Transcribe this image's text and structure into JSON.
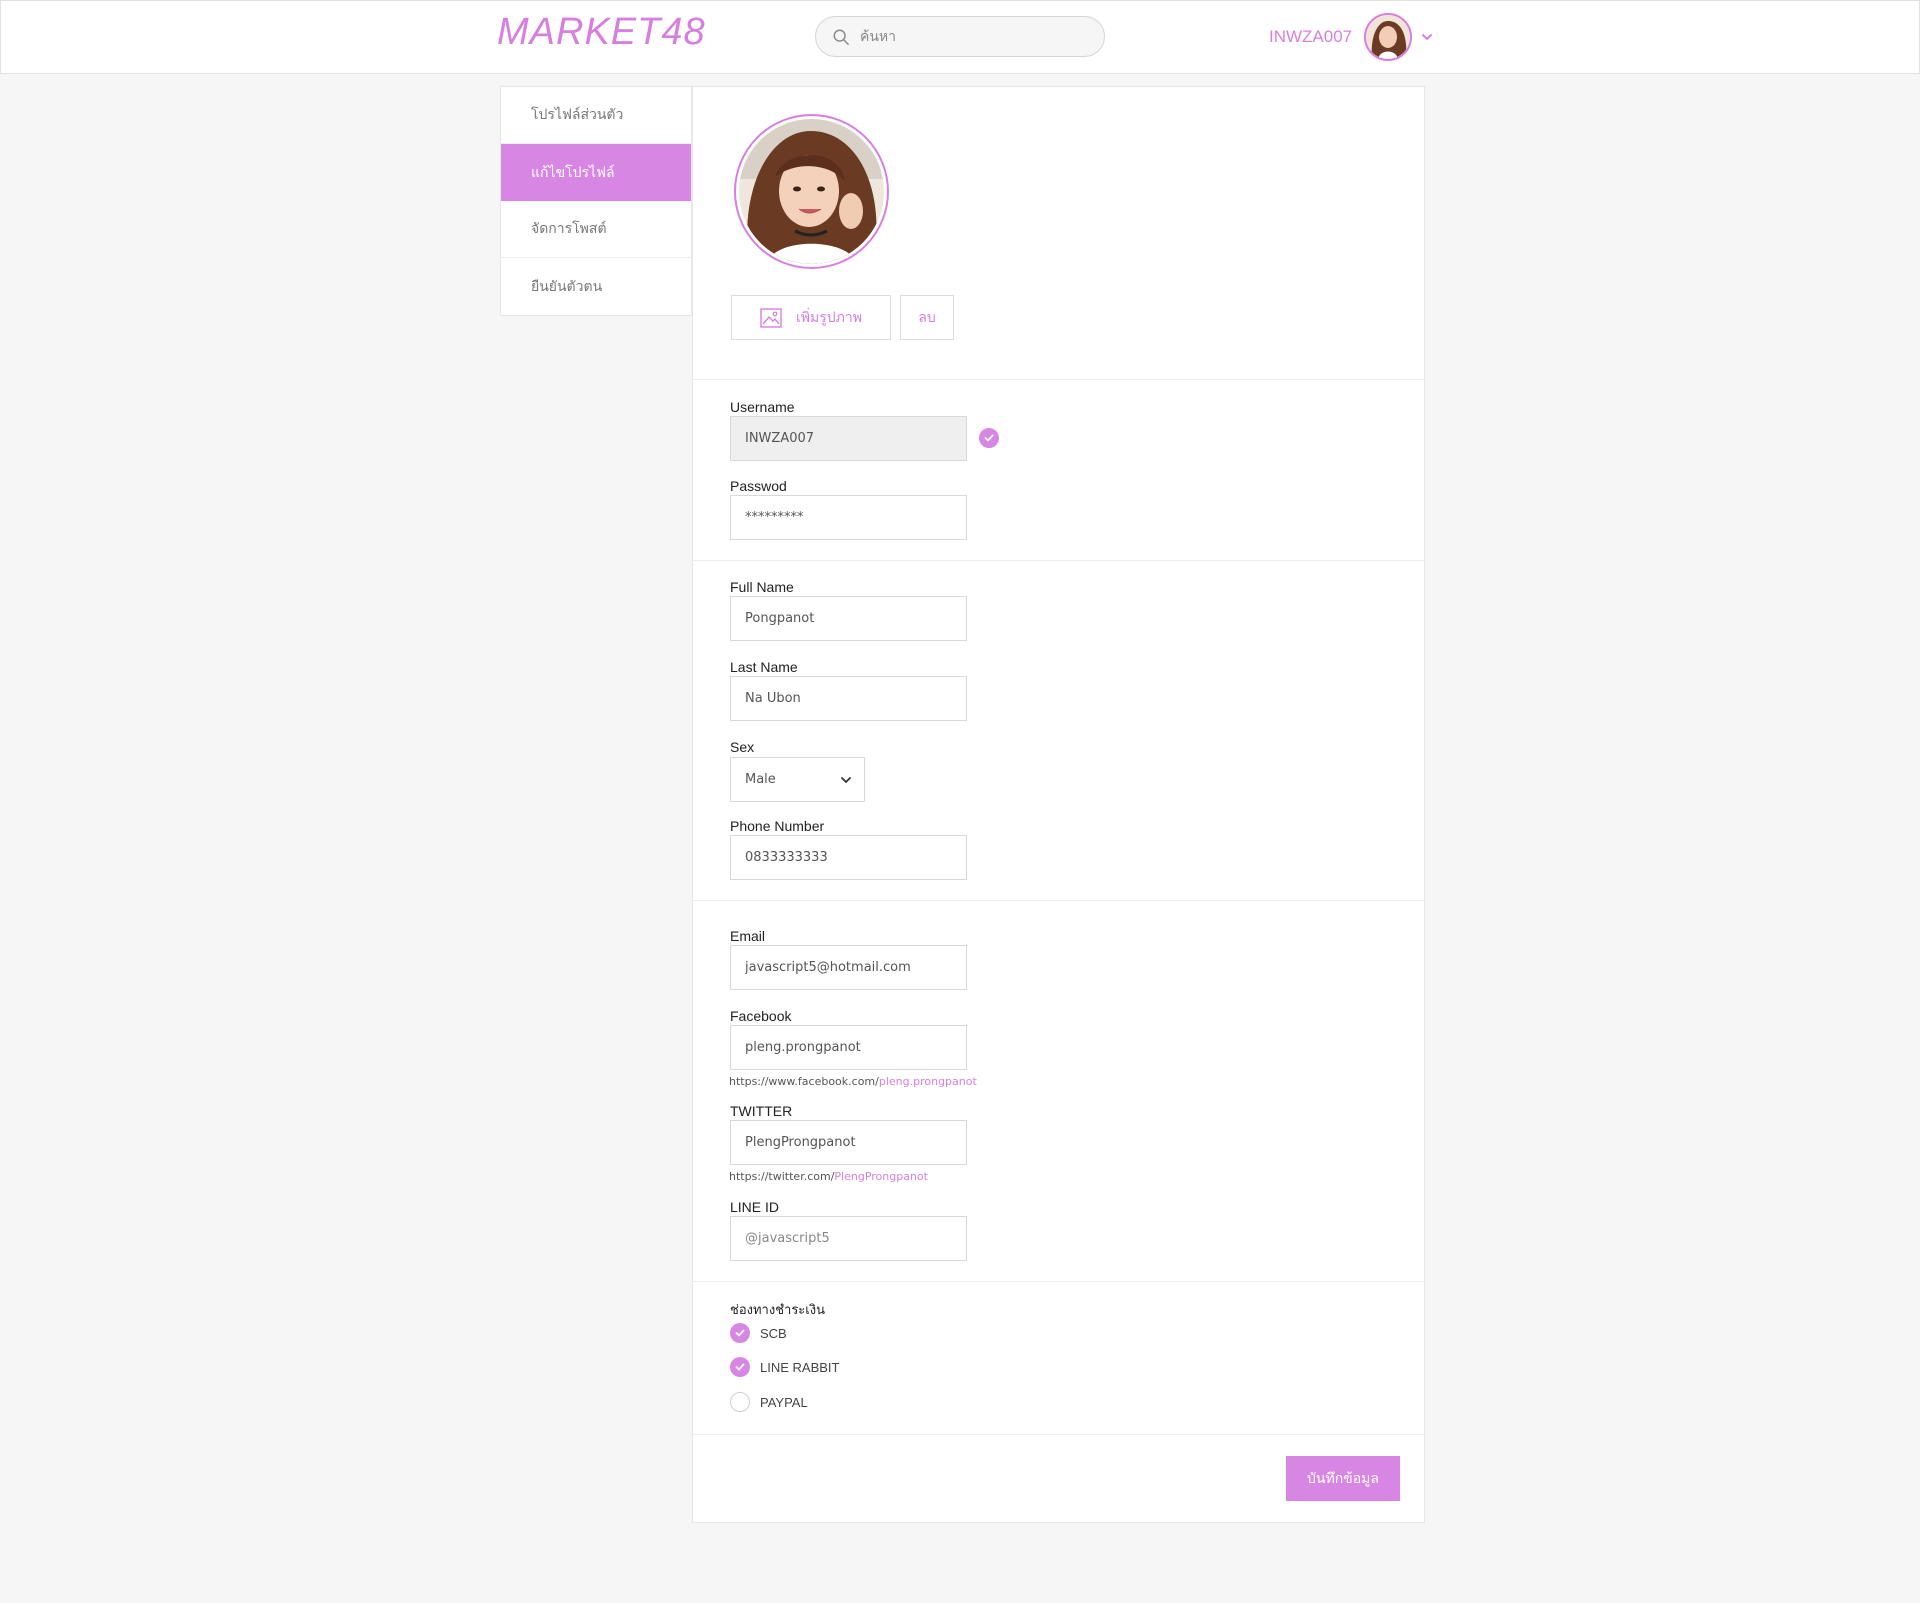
{
  "header": {
    "logo": "MARKET48",
    "search_placeholder": "ค้นหา",
    "username": "INWZA007"
  },
  "sidebar": {
    "items": [
      {
        "label": "โปรไฟล์ส่วนตัว",
        "active": false
      },
      {
        "label": "แก้ไขโปรไฟล์",
        "active": true
      },
      {
        "label": "จัดการโพสต์",
        "active": false
      },
      {
        "label": "ยืนยันตัวตน",
        "active": false
      }
    ]
  },
  "photo": {
    "add_label": "เพิ่มรูปภาพ",
    "delete_label": "ลบ"
  },
  "account": {
    "username_label": "Username",
    "username_value": "INWZA007",
    "password_label": "Passwod",
    "password_value": "*********"
  },
  "personal": {
    "fullname_label": "Full Name",
    "fullname_value": "Pongpanot",
    "lastname_label": "Last Name",
    "lastname_value": "Na Ubon",
    "sex_label": "Sex",
    "sex_value": "Male",
    "phone_label": "Phone Number",
    "phone_value": "0833333333"
  },
  "contact": {
    "email_label": "Email",
    "email_value": "javascript5@hotmail.com",
    "facebook_label": "Facebook",
    "facebook_value": "pleng.prongpanot",
    "facebook_hint_prefix": "https://www.facebook.com/",
    "facebook_hint_user": "pleng.prongpanot",
    "twitter_label": "TWITTER",
    "twitter_value": "PlengProngpanot",
    "twitter_hint_prefix": "https://twitter.com/",
    "twitter_hint_user": "PlengProngpanot",
    "line_label": "LINE ID",
    "line_placeholder": "@javascript5"
  },
  "payment": {
    "title": "ช่องทางชำระเงิน",
    "options": [
      {
        "label": "SCB",
        "checked": true
      },
      {
        "label": "LINE RABBIT",
        "checked": true
      },
      {
        "label": "PAYPAL",
        "checked": false
      }
    ]
  },
  "save_label": "บันทึกข้อมูล",
  "colors": {
    "accent": "#d886e3",
    "background": "#f6f6f6"
  }
}
